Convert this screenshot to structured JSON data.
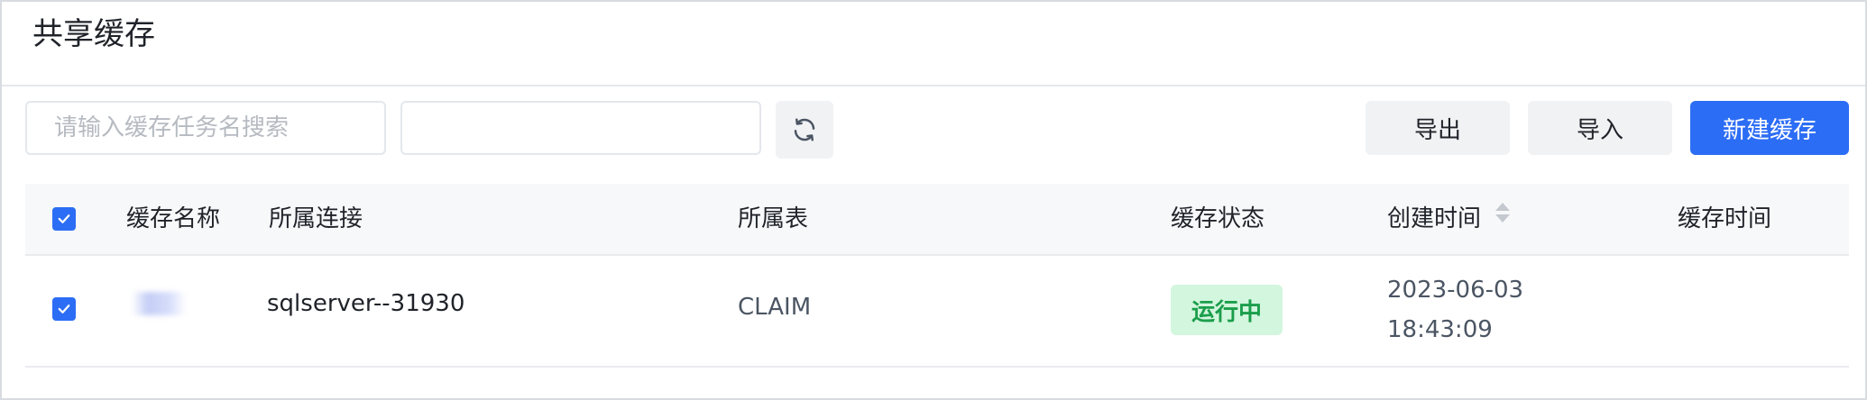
{
  "header": {
    "title": "共享缓存"
  },
  "toolbar": {
    "search_placeholder": "请输入缓存任务名搜索",
    "search_value": "",
    "filter_value": "",
    "refresh_icon": "refresh-icon",
    "export_label": "导出",
    "import_label": "导入",
    "new_label": "新建缓存"
  },
  "table": {
    "columns": [
      "缓存名称",
      "所属连接",
      "所属表",
      "缓存状态",
      "创建时间",
      "缓存时间"
    ],
    "select_all_checked": true,
    "rows": [
      {
        "checked": true,
        "name": "",
        "connection": "sqlserver--31930",
        "table": "CLAIM",
        "status": "运行中",
        "created_date": "2023-06-03",
        "created_time": "18:43:09",
        "cache_time": ""
      }
    ]
  },
  "colors": {
    "primary": "#2c6df5",
    "status_running_bg": "#d3f6de",
    "status_running_text": "#1b9e4b"
  }
}
